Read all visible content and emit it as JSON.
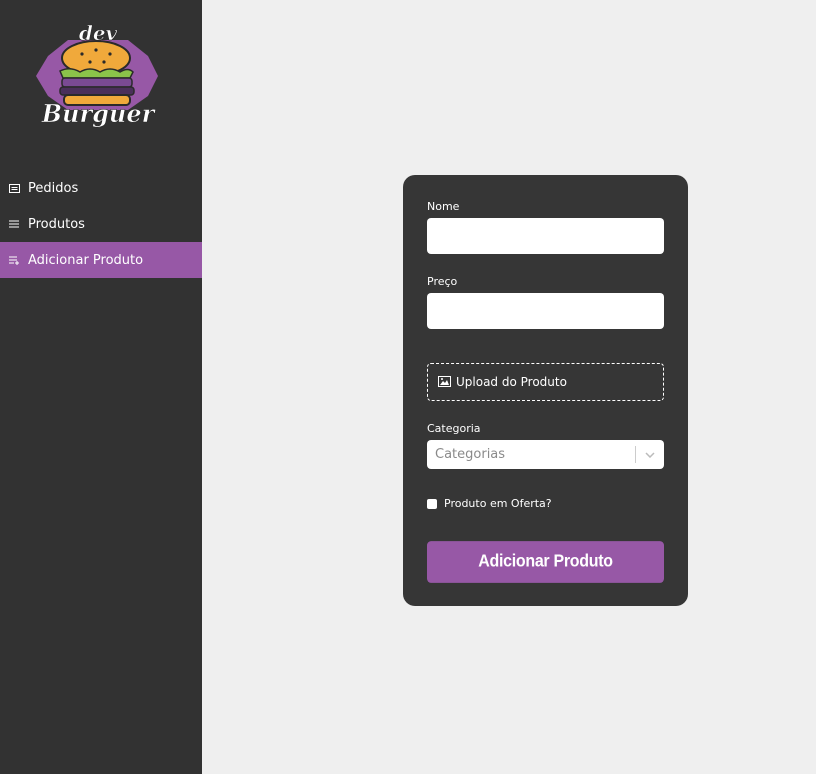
{
  "logo": {
    "line1": "dev",
    "line2": "Burguer"
  },
  "sidebar": {
    "items": [
      {
        "label": "Pedidos",
        "icon": "receipt-icon",
        "active": false
      },
      {
        "label": "Produtos",
        "icon": "list-icon",
        "active": false
      },
      {
        "label": "Adicionar Produto",
        "icon": "playlist-add-icon",
        "active": true
      }
    ]
  },
  "form": {
    "name_label": "Nome",
    "name_value": "",
    "price_label": "Preço",
    "price_value": "",
    "upload_label": "Upload do Produto",
    "category_label": "Categoria",
    "category_placeholder": "Categorias",
    "offer_label": "Produto em Oferta?",
    "submit_label": "Adicionar Produto"
  },
  "colors": {
    "sidebar_bg": "#323232",
    "accent": "#9758a6",
    "card_bg": "#363636",
    "page_bg": "#efefef"
  }
}
